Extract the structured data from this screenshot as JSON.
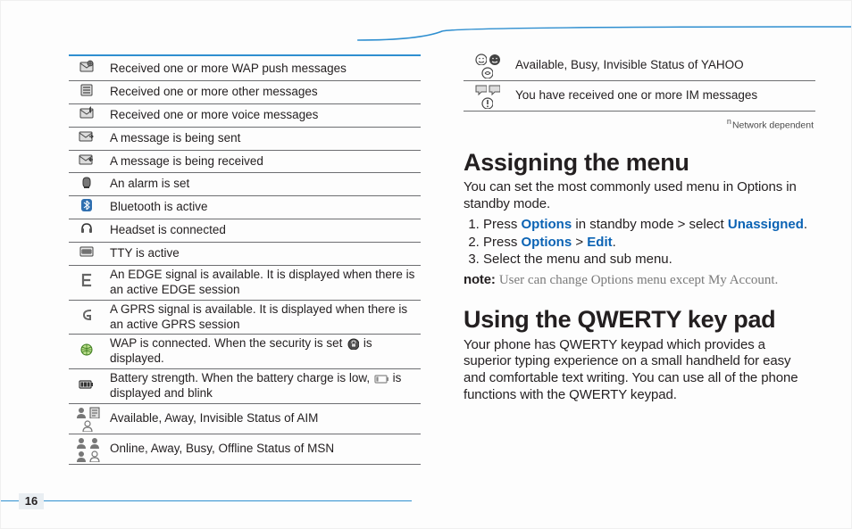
{
  "page_number": "16",
  "network_note": {
    "sup": "n",
    "text": "Network dependent"
  },
  "icon_rows": [
    {
      "icon": "wap-push-message-icon",
      "desc": "Received one or more WAP push messages"
    },
    {
      "icon": "other-message-icon",
      "desc": "Received one or more other messages"
    },
    {
      "icon": "voice-message-icon",
      "desc": "Received one or more voice messages"
    },
    {
      "icon": "message-sending-icon",
      "desc": "A message is being sent"
    },
    {
      "icon": "message-receiving-icon",
      "desc": "A message is being received"
    },
    {
      "icon": "alarm-icon",
      "desc": "An alarm is set"
    },
    {
      "icon": "bluetooth-icon",
      "desc": "Bluetooth is active"
    },
    {
      "icon": "headset-icon",
      "desc": "Headset is connected"
    },
    {
      "icon": "tty-icon",
      "desc": "TTY is active"
    },
    {
      "icon": "edge-icon",
      "desc": "An EDGE signal is available. It is displayed when there is an active EDGE session"
    },
    {
      "icon": "gprs-icon",
      "desc": "A GPRS signal is available. It is displayed when there is an active GPRS session"
    },
    {
      "icon": "wap-connected-icon",
      "desc_parts": {
        "pre": "WAP is connected. When the security is set ",
        "icon": "wap-secure-icon",
        "post": " is displayed."
      }
    },
    {
      "icon": "battery-icon",
      "desc_parts": {
        "pre": "Battery strength. When the battery charge is low, ",
        "icon": "battery-low-icon",
        "post": " is displayed and blink"
      }
    },
    {
      "icon": "aim-status-icons",
      "desc": "Available, Away, Invisible Status of AIM"
    },
    {
      "icon": "msn-status-icons",
      "desc": "Online, Away, Busy, Offline Status of MSN"
    }
  ],
  "right_rows": [
    {
      "icon": "yahoo-status-icons",
      "desc": "Available, Busy, Invisible Status of YAHOO"
    },
    {
      "icon": "im-message-icons",
      "desc": "You have received one or more IM messages"
    }
  ],
  "assign": {
    "heading": "Assigning the menu",
    "intro": "You can set the most commonly used menu in Options in standby mode.",
    "step1_pre": "Press ",
    "step1_opt": "Options",
    "step1_mid": " in standby mode > select ",
    "step1_sel": "Unassigned",
    "step1_post": ".",
    "step2_pre": "Press ",
    "step2_opt": "Options",
    "step2_mid": " > ",
    "step2_edit": "Edit",
    "step2_post": ".",
    "step3": "Select the menu and sub menu.",
    "note_label": "note:",
    "note_pre": " User can change ",
    "note_opt": "Options",
    "note_mid": " menu except ",
    "note_my": "My Account",
    "note_post": "."
  },
  "qwerty": {
    "heading": "Using the QWERTY key pad",
    "body": "Your phone has QWERTY keypad which provides a superior typing experience on a small handheld for easy and comfortable text writing. You can use all of the phone functions with the QWERTY keypad."
  }
}
